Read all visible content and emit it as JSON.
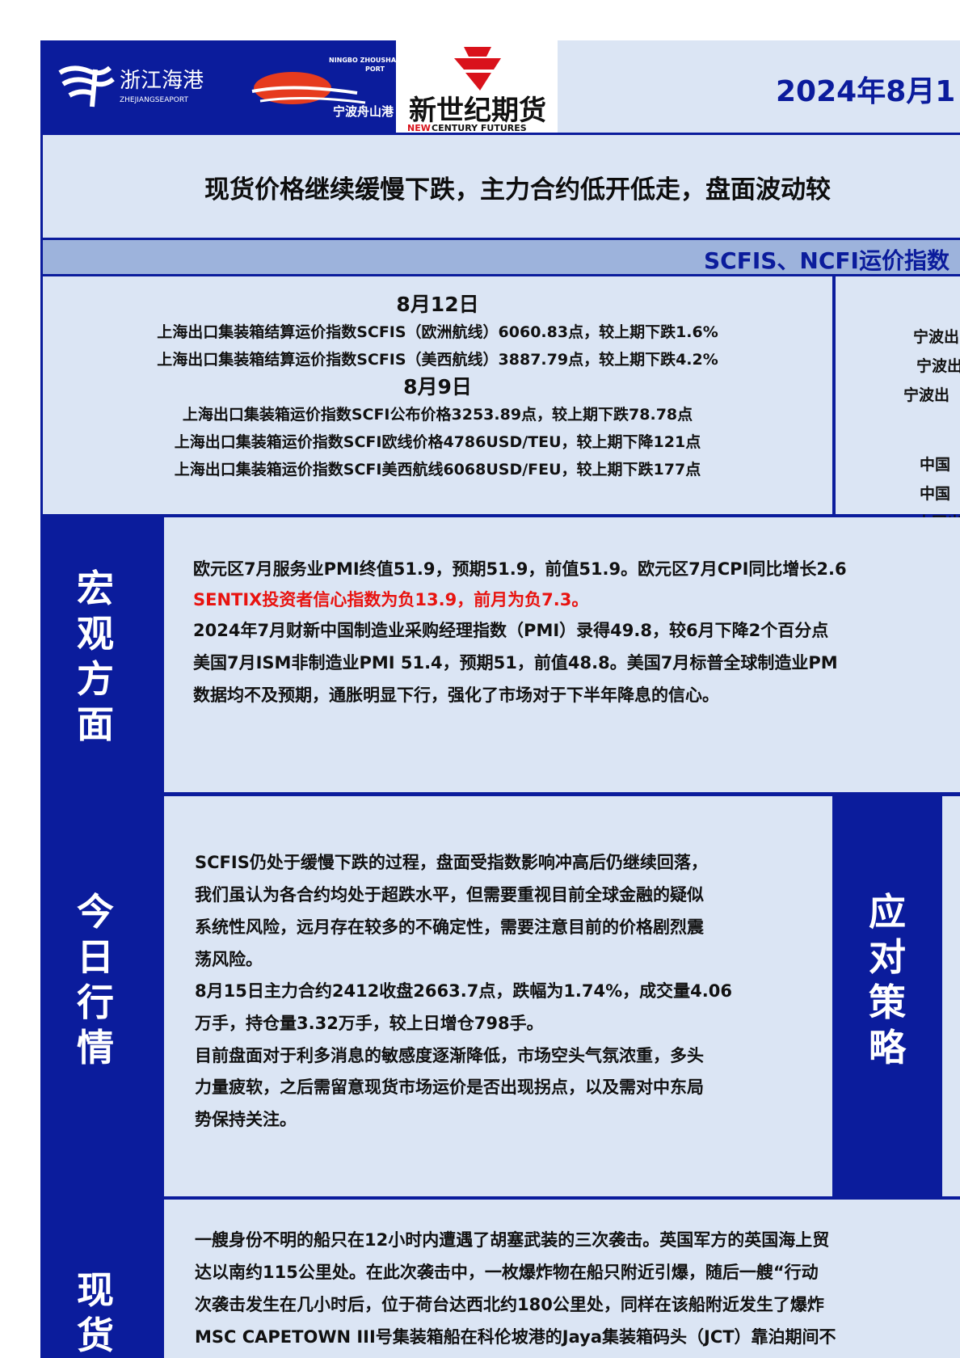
{
  "header": {
    "logos": {
      "zhejiang_cn": "浙江海港",
      "zhejiang_en": "ZHEJIANGSEAPORT",
      "ningbo_en_1": "NINGBO ZHOUSHAN",
      "ningbo_en_2": "PORT",
      "ningbo_cn": "宁波舟山港",
      "newcentury_cn": "新世纪期货",
      "newcentury_en_1": "NEW",
      "newcentury_en_2": "CENTURY FUTURES"
    },
    "date": "2024年8月1"
  },
  "headline": "现货价格继续缓慢下跌，主力合约低开低走，盘面波动较",
  "section_title": "SCFIS、NCFI运价指数",
  "indices_left": {
    "date1": "8月12日",
    "line1": "上海出口集装箱结算运价指数SCFIS（欧洲航线）6060.83点，较上期下跌1.6%",
    "line2": "上海出口集装箱结算运价指数SCFIS（美西航线）3887.79点，较上期下跌4.2%",
    "date2": "8月9日",
    "line3": "上海出口集装箱运价指数SCFI公布价格3253.89点，较上期下跌78.78点",
    "line4": "上海出口集装箱运价指数SCFI欧线价格4786USD/TEU，较上期下降121点",
    "line5": "上海出口集装箱运价指数SCFI美西航线6068USD/FEU，较上期下跌177点"
  },
  "indices_right": {
    "r1": "宁波出",
    "r2": "宁波出",
    "r3": "宁波出",
    "r4": "中国",
    "r5": "中国",
    "r6": "中国出"
  },
  "macro": {
    "label": "宏观方面",
    "p1": "欧元区7月服务业PMI终值51.9，预期51.9，前值51.9。欧元区7月CPI同比增长2.6",
    "p2_red": "SENTIX投资者信心指数为负13.9，前月为负7.3。",
    "p3": "2024年7月财新中国制造业采购经理指数（PMI）录得49.8，较6月下降2个百分点",
    "p4": "美国7月ISM非制造业PMI 51.4，预期51，前值48.8。美国7月标普全球制造业PM",
    "p5": "数据均不及预期，通胀明显下行，强化了市场对于下半年降息的信心。"
  },
  "today": {
    "label": "今日行情",
    "p1": "SCFIS仍处于缓慢下跌的过程，盘面受指数影响冲高后仍继续回落，",
    "p2": "我们虽认为各合约均处于超跌水平，但需要重视目前全球金融的疑似",
    "p3": "系统性风险，远月存在较多的不确定性，需要注意目前的价格剧烈震",
    "p4": "荡风险。",
    "p5": "8月15日主力合约2412收盘2663.7点，跌幅为1.74%，成交量4.06",
    "p6": "万手，持仓量3.32万手，较上日增仓798手。",
    "p7": "目前盘面对于利多消息的敏感度逐渐降低，市场空头气氛浓重，多头",
    "p8": "力量疲软，之后需留意现货市场运价是否出现拐点，以及需对中东局",
    "p9": "势保持关注。"
  },
  "strategy": {
    "label": "应对策略"
  },
  "spot": {
    "label": "现货",
    "p1": "一艘身份不明的船只在12小时内遭遇了胡塞武装的三次袭击。英国军方的英国海上贸",
    "p2": "达以南约115公里处。在此次袭击中，一枚爆炸物在船只附近引爆，随后一艘“行动",
    "p3": "次袭击发生在几小时后，位于荷台达西北约180公里处，同样在该船附近发生了爆炸",
    "p4": "MSC CAPETOWN III号集装箱船在科伦坡港的Jaya集装箱码头（JCT）靠泊期间不"
  },
  "colors": {
    "navy": "#0b1c9c",
    "light": "#dbe5f4",
    "band": "#9db3dc",
    "red": "#e8130f"
  }
}
